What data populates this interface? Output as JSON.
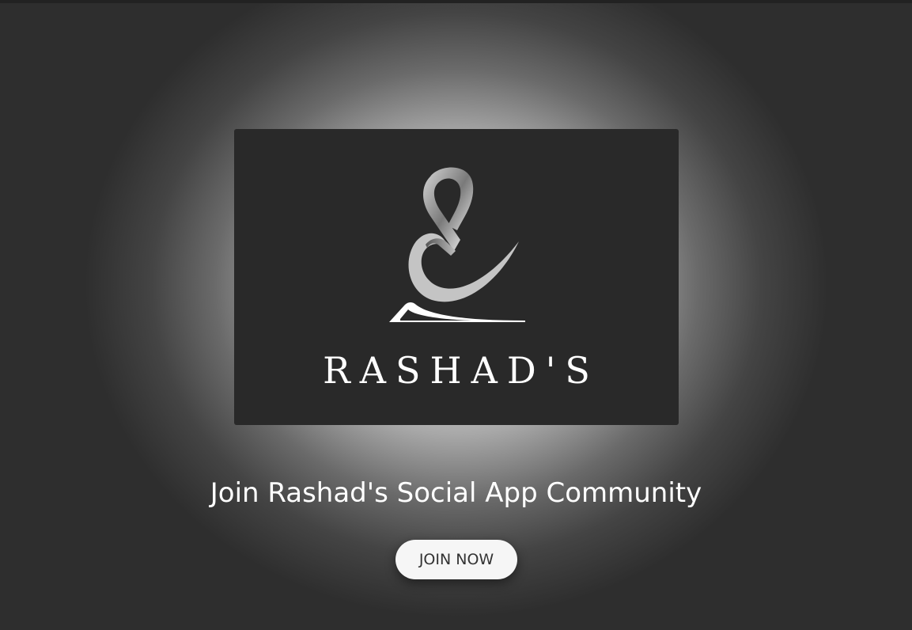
{
  "logo": {
    "icon": "ampersand-quill-logo",
    "brand_name": "RASHAD'S"
  },
  "hero": {
    "headline": "Join Rashad's Social App Community",
    "cta_label": "JOIN NOW"
  },
  "colors": {
    "card_background": "#292929",
    "page_background": "#2b2b2b",
    "glow": "#f2f2f2",
    "button_background": "#f6f6f6",
    "button_text": "#333333"
  }
}
